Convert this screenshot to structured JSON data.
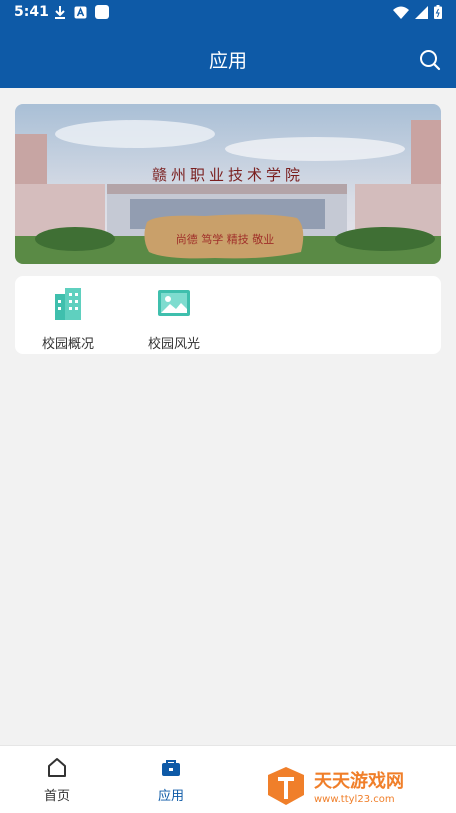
{
  "status_bar": {
    "time": "5:41"
  },
  "header": {
    "title": "应用",
    "search_icon": "search-icon"
  },
  "banner": {
    "headline": "赣州职业技术学院",
    "stone_text": "尚德 笃学 精技 敬业"
  },
  "apps": [
    {
      "label": "校园概况",
      "icon": "building-icon",
      "color": "#3fbfad"
    },
    {
      "label": "校园风光",
      "icon": "image-icon",
      "color": "#3fbfad"
    }
  ],
  "bottom_nav": [
    {
      "label": "首页",
      "icon": "home-icon",
      "active": false
    },
    {
      "label": "应用",
      "icon": "briefcase-icon",
      "active": true
    }
  ],
  "watermark": {
    "name": "天天游戏网",
    "url": "www.ttyl23.com"
  },
  "colors": {
    "primary": "#0e5aa7",
    "accent": "#3fbfad",
    "background": "#f2f2f2"
  }
}
